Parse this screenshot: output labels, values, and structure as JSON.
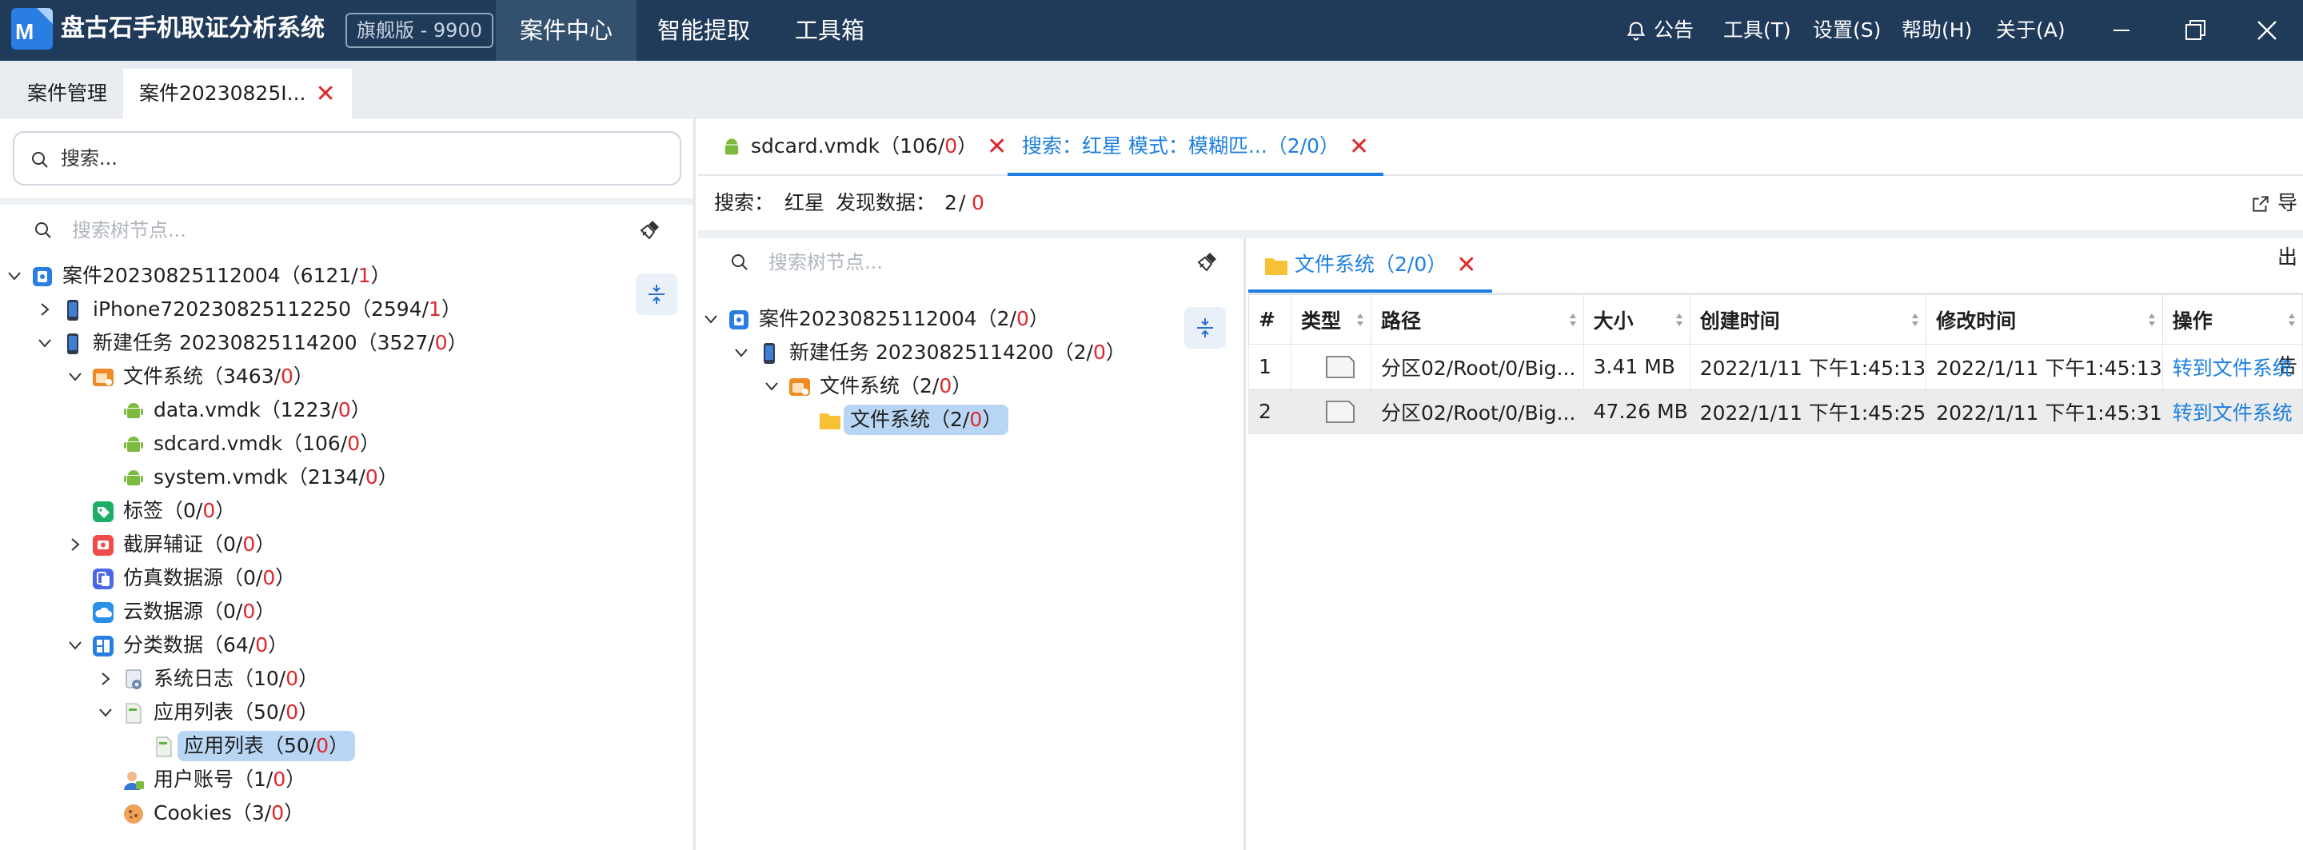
{
  "app": {
    "title": "盘古石手机取证分析系统",
    "edition": "旗舰版 - 9900",
    "menus": [
      "案件中心",
      "智能提取",
      "工具箱"
    ],
    "active_menu": "案件中心"
  },
  "toolbar": {
    "notice": "公告",
    "tools": "工具(T)",
    "settings": "设置(S)",
    "help": "帮助(H)",
    "about": "关于(A)"
  },
  "tabs": [
    {
      "label": "案件管理"
    },
    {
      "label": "案件20230825I..."
    }
  ],
  "left": {
    "search_placeholder": "搜索...",
    "filter_placeholder": "搜索树节点...",
    "tree": [
      {
        "label": "案件20230825112004（6121/",
        "count": "1",
        "tail": "）",
        "icon": "case-icon",
        "arrow": "down"
      },
      {
        "label": "iPhone720230825112250（2594/",
        "count": "1",
        "tail": "）",
        "icon": "phone-icon",
        "arrow": "right"
      },
      {
        "label": "新建任务 20230825114200（3527/",
        "count": "0",
        "tail": "）",
        "icon": "phone-icon",
        "arrow": "down"
      },
      {
        "label": "文件系统（3463/",
        "count": "0",
        "tail": "）",
        "icon": "filesystem-icon",
        "arrow": "down"
      },
      {
        "label": "data.vmdk（1223/",
        "count": "0",
        "tail": "）",
        "icon": "android-icon",
        "arrow": ""
      },
      {
        "label": "sdcard.vmdk（106/",
        "count": "0",
        "tail": "）",
        "icon": "android-icon",
        "arrow": ""
      },
      {
        "label": "system.vmdk（2134/",
        "count": "0",
        "tail": "）",
        "icon": "android-icon",
        "arrow": ""
      },
      {
        "label": "标签（0/",
        "count": "0",
        "tail": "）",
        "icon": "tag-icon",
        "arrow": ""
      },
      {
        "label": "截屏辅证（0/",
        "count": "0",
        "tail": "）",
        "icon": "screenshot-icon",
        "arrow": "right"
      },
      {
        "label": "仿真数据源（0/",
        "count": "0",
        "tail": "）",
        "icon": "emulation-icon",
        "arrow": ""
      },
      {
        "label": "云数据源（0/",
        "count": "0",
        "tail": "）",
        "icon": "cloud-icon",
        "arrow": ""
      },
      {
        "label": "分类数据（64/",
        "count": "0",
        "tail": "）",
        "icon": "category-icon",
        "arrow": "down"
      },
      {
        "label": "系统日志（10/",
        "count": "0",
        "tail": "）",
        "icon": "gear-log-icon",
        "arrow": "right"
      },
      {
        "label": "应用列表（50/",
        "count": "0",
        "tail": "）",
        "icon": "doc-icon",
        "arrow": "down"
      },
      {
        "label": "应用列表（50/",
        "count": "0",
        "tail": "）",
        "icon": "doc-icon",
        "arrow": ""
      },
      {
        "label": "用户账号（1/",
        "count": "0",
        "tail": "）",
        "icon": "user-icon",
        "arrow": ""
      },
      {
        "label": "Cookies（3/",
        "count": "0",
        "tail": "）",
        "icon": "cookie-icon",
        "arrow": ""
      }
    ]
  },
  "right": {
    "tabs": [
      {
        "label": "sdcard.vmdk（106/",
        "count": "0",
        "tail": "）"
      },
      {
        "label": "搜索：红星  模式：模糊匹...（2/0）"
      }
    ],
    "info": {
      "search_label": "搜索：",
      "keyword": "红星",
      "found_label": "发现数据：",
      "found": "2",
      "slash": "/",
      "found_red": "0",
      "export": "导出报告"
    },
    "filter_placeholder": "搜索树节点...",
    "tree": [
      {
        "label": "案件20230825112004（2/",
        "count": "0",
        "tail": "）",
        "icon": "case-icon",
        "arrow": "down"
      },
      {
        "label": "新建任务 20230825114200（2/",
        "count": "0",
        "tail": "）",
        "icon": "phone-icon",
        "arrow": "down"
      },
      {
        "label": "文件系统（2/",
        "count": "0",
        "tail": "）",
        "icon": "filesystem-icon",
        "arrow": "down"
      },
      {
        "label": "文件系统（2/",
        "count": "0",
        "tail": "）",
        "icon": "folder-icon",
        "arrow": ""
      }
    ],
    "grid_tab": "文件系统（2/0）",
    "columns": [
      "#",
      "类型",
      "路径",
      "大小",
      "创建时间",
      "修改时间",
      "操作"
    ],
    "rows": [
      {
        "idx": "1",
        "path": "分区02/Root/0/Big...",
        "size": "3.41 MB",
        "created": "2022/1/11 下午1:45:13",
        "modified": "2022/1/11 下午1:45:13",
        "action": "转到文件系统"
      },
      {
        "idx": "2",
        "path": "分区02/Root/0/Big...",
        "size": "47.26 MB",
        "created": "2022/1/11 下午1:45:25",
        "modified": "2022/1/11 下午1:45:31",
        "action": "转到文件系统"
      }
    ]
  }
}
